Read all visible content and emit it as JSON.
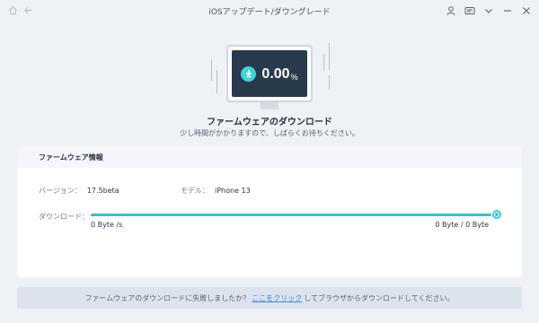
{
  "window": {
    "title": "iOSアップデート/ダウングレード",
    "icons": [
      "home-icon",
      "back-arrow-icon",
      "user-icon",
      "feedback-icon",
      "chevron-down-icon",
      "minimize-icon",
      "close-icon"
    ]
  },
  "hero": {
    "percent": "0.00",
    "percent_unit": "%",
    "progress_value": 0,
    "title": "ファームウェアのダウンロード",
    "subtitle": "少し時間がかかりますので、しばらくお待ちください。"
  },
  "firmware": {
    "header": "ファームウェア情報",
    "version_label": "バージョン：",
    "version_value": "17.5beta",
    "model_label": "モデル：",
    "model_value": "iPhone 13",
    "download_label": "ダウンロード：",
    "download_progress": 1.0,
    "speed": "0 Byte /s",
    "bytes": "0 Byte / 0 Byte"
  },
  "notice": {
    "before": "ファームウェアのダウンロードに失敗しましたか？",
    "link": "ここをクリック",
    "after": "してブラウザからダウンロードしてください。"
  },
  "colors": {
    "accent": "#2ec7cc",
    "link": "#2c8fd8",
    "screen": "#293a4d",
    "background": "#eef1f6"
  }
}
